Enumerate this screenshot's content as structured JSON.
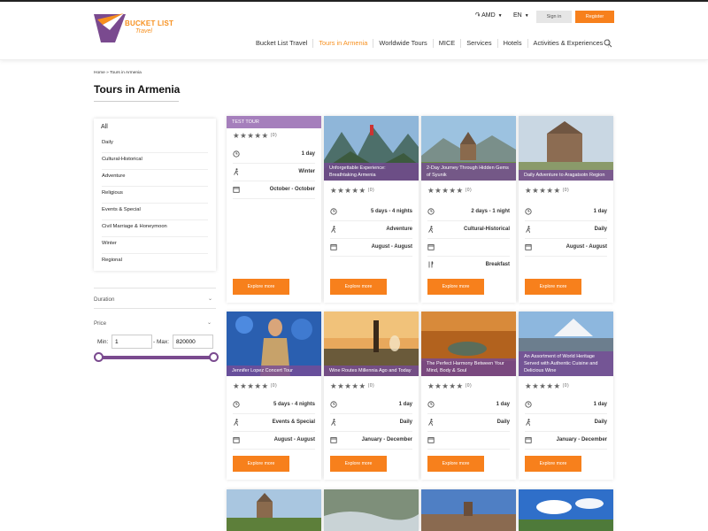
{
  "header": {
    "logo_text_1": "BUCKET LIST",
    "logo_text_2": "Travel",
    "currency": "֏ AMD",
    "language": "EN",
    "signin_label": "Sign in",
    "register_label": "Register",
    "nav": [
      "Bucket List Travel",
      "Tours in Armenia",
      "Worldwide Tours",
      "MICE",
      "Services",
      "Hotels",
      "Activities & Experiences"
    ],
    "active_nav": "Tours in Armenia",
    "accent_color": "#f7901e",
    "brand_purple": "#7a4a8f"
  },
  "breadcrumb": {
    "home": "Home",
    "sep": "»",
    "current": "Tours in Armenia"
  },
  "page_title": "Tours in Armenia",
  "filters": {
    "all": "All",
    "categories": [
      "Daily",
      "Cultural-Historical",
      "Adventure",
      "Religious",
      "Events & Special",
      "Civil Marriage & Honeymoon",
      "Winter",
      "Regional"
    ],
    "duration_label": "Duration",
    "price_label": "Price",
    "min_label": "Min:",
    "min_value": "1",
    "max_label": "- Max:",
    "max_value": "820000"
  },
  "cards": [
    {
      "badge": "TEST TOUR",
      "caption": "",
      "rating_count": "(0)",
      "duration": "1 day",
      "type": "Winter",
      "season": "October - October",
      "extra": "",
      "button": "Explore more"
    },
    {
      "caption": "Unforgettable Experience: Breathtaking Armenia",
      "rating_count": "(0)",
      "duration": "5 days - 4 nights",
      "type": "Adventure",
      "season": "August - August",
      "extra": "",
      "button": "Explore more"
    },
    {
      "caption": "2-Day Journey Through Hidden Gems of Syunik",
      "rating_count": "(0)",
      "duration": "2 days - 1 night",
      "type": "Cultural-Historical",
      "season": "",
      "extra": "Breakfast",
      "button": "Explore more"
    },
    {
      "caption": "Daily Adventure to Aragatsotn Region",
      "rating_count": "(0)",
      "duration": "1 day",
      "type": "Daily",
      "season": "August - August",
      "extra": "",
      "button": "Explore more"
    },
    {
      "caption": "Jennifer Lopez Concert Tour",
      "rating_count": "(0)",
      "duration": "5 days - 4 nights",
      "type": "Events & Special",
      "season": "August - August",
      "extra": "",
      "button": "Explore more"
    },
    {
      "caption": "Wine Routes Millennia Ago and Today",
      "rating_count": "(0)",
      "duration": "1 day",
      "type": "Daily",
      "season": "January - December",
      "extra": "",
      "button": "Explore more"
    },
    {
      "caption": "The Perfect Harmony Between Your Mind, Body & Soul",
      "rating_count": "(0)",
      "duration": "1 day",
      "type": "Daily",
      "season": "",
      "extra": "",
      "button": "Explore more"
    },
    {
      "caption": "An Assortment of World Heritage Served with Authentic Cuisine and Delicious Wine",
      "rating_count": "(0)",
      "duration": "1 day",
      "type": "Daily",
      "season": "January - December",
      "extra": "",
      "button": "Explore more"
    }
  ],
  "stars_glyph": "★★★★★",
  "icons": {
    "duration": "clock-icon",
    "type": "hiker-icon",
    "season": "calendar-icon",
    "meal": "utensils-icon",
    "search": "search-icon"
  }
}
